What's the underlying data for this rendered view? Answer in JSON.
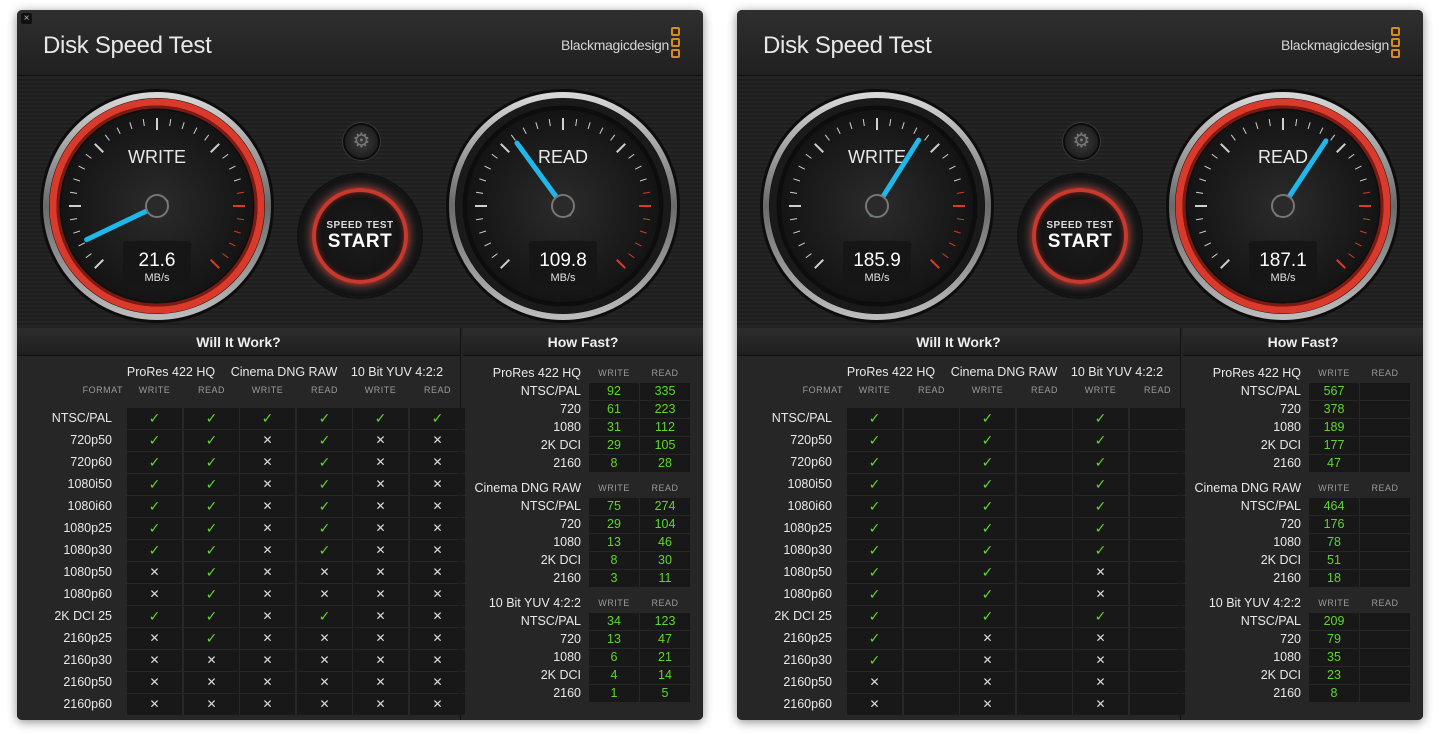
{
  "windows": [
    {
      "close_label": "×",
      "title": "Disk Speed Test",
      "brand": "Blackmagicdesign",
      "write_gauge": {
        "label": "WRITE",
        "value": "21.6",
        "unit": "MB/s",
        "needle_mbps": 21.6
      },
      "read_gauge": {
        "label": "READ",
        "value": "109.8",
        "unit": "MB/s",
        "needle_mbps": 109.8
      },
      "gauge_max_mbps": 300,
      "active_gauge": "write",
      "start_button": {
        "line1": "SPEED TEST",
        "line2": "START"
      },
      "will_it_work": {
        "title": "Will It Work?",
        "format_label": "FORMAT",
        "codecs": [
          "ProRes 422 HQ",
          "Cinema DNG RAW",
          "10 Bit YUV 4:2:2"
        ],
        "subcols": [
          "WRITE",
          "READ"
        ],
        "rows": [
          {
            "format": "NTSC/PAL",
            "cells": [
              "ok",
              "ok",
              "ok",
              "ok",
              "ok",
              "ok"
            ]
          },
          {
            "format": "720p50",
            "cells": [
              "ok",
              "ok",
              "no",
              "ok",
              "no",
              "no"
            ]
          },
          {
            "format": "720p60",
            "cells": [
              "ok",
              "ok",
              "no",
              "ok",
              "no",
              "no"
            ]
          },
          {
            "format": "1080i50",
            "cells": [
              "ok",
              "ok",
              "no",
              "ok",
              "no",
              "no"
            ]
          },
          {
            "format": "1080i60",
            "cells": [
              "ok",
              "ok",
              "no",
              "ok",
              "no",
              "no"
            ]
          },
          {
            "format": "1080p25",
            "cells": [
              "ok",
              "ok",
              "no",
              "ok",
              "no",
              "no"
            ]
          },
          {
            "format": "1080p30",
            "cells": [
              "ok",
              "ok",
              "no",
              "ok",
              "no",
              "no"
            ]
          },
          {
            "format": "1080p50",
            "cells": [
              "no",
              "ok",
              "no",
              "no",
              "no",
              "no"
            ]
          },
          {
            "format": "1080p60",
            "cells": [
              "no",
              "ok",
              "no",
              "no",
              "no",
              "no"
            ]
          },
          {
            "format": "2K DCI 25",
            "cells": [
              "ok",
              "ok",
              "no",
              "ok",
              "no",
              "no"
            ]
          },
          {
            "format": "2160p25",
            "cells": [
              "no",
              "ok",
              "no",
              "no",
              "no",
              "no"
            ]
          },
          {
            "format": "2160p30",
            "cells": [
              "no",
              "no",
              "no",
              "no",
              "no",
              "no"
            ]
          },
          {
            "format": "2160p50",
            "cells": [
              "no",
              "no",
              "no",
              "no",
              "no",
              "no"
            ]
          },
          {
            "format": "2160p60",
            "cells": [
              "no",
              "no",
              "no",
              "no",
              "no",
              "no"
            ]
          }
        ]
      },
      "how_fast": {
        "title": "How Fast?",
        "write_label": "WRITE",
        "read_label": "READ",
        "groups": [
          {
            "name": "ProRes 422 HQ",
            "rows": [
              {
                "res": "NTSC/PAL",
                "write": "92",
                "read": "335"
              },
              {
                "res": "720",
                "write": "61",
                "read": "223"
              },
              {
                "res": "1080",
                "write": "31",
                "read": "112"
              },
              {
                "res": "2K DCI",
                "write": "29",
                "read": "105"
              },
              {
                "res": "2160",
                "write": "8",
                "read": "28"
              }
            ]
          },
          {
            "name": "Cinema DNG RAW",
            "rows": [
              {
                "res": "NTSC/PAL",
                "write": "75",
                "read": "274"
              },
              {
                "res": "720",
                "write": "29",
                "read": "104"
              },
              {
                "res": "1080",
                "write": "13",
                "read": "46"
              },
              {
                "res": "2K DCI",
                "write": "8",
                "read": "30"
              },
              {
                "res": "2160",
                "write": "3",
                "read": "11"
              }
            ]
          },
          {
            "name": "10 Bit YUV 4:2:2",
            "rows": [
              {
                "res": "NTSC/PAL",
                "write": "34",
                "read": "123"
              },
              {
                "res": "720",
                "write": "13",
                "read": "47"
              },
              {
                "res": "1080",
                "write": "6",
                "read": "21"
              },
              {
                "res": "2K DCI",
                "write": "4",
                "read": "14"
              },
              {
                "res": "2160",
                "write": "1",
                "read": "5"
              }
            ]
          }
        ]
      }
    },
    {
      "close_label": "",
      "title": "Disk Speed Test",
      "brand": "Blackmagicdesign",
      "write_gauge": {
        "label": "WRITE",
        "value": "185.9",
        "unit": "MB/s",
        "needle_mbps": 185.9
      },
      "read_gauge": {
        "label": "READ",
        "value": "187.1",
        "unit": "MB/s",
        "needle_mbps": 187.1
      },
      "gauge_max_mbps": 300,
      "active_gauge": "read",
      "start_button": {
        "line1": "SPEED TEST",
        "line2": "START"
      },
      "will_it_work": {
        "title": "Will It Work?",
        "format_label": "FORMAT",
        "codecs": [
          "ProRes 422 HQ",
          "Cinema DNG RAW",
          "10 Bit YUV 4:2:2"
        ],
        "subcols": [
          "WRITE",
          "READ"
        ],
        "rows": [
          {
            "format": "NTSC/PAL",
            "cells": [
              "ok",
              "",
              "ok",
              "",
              "ok",
              ""
            ]
          },
          {
            "format": "720p50",
            "cells": [
              "ok",
              "",
              "ok",
              "",
              "ok",
              ""
            ]
          },
          {
            "format": "720p60",
            "cells": [
              "ok",
              "",
              "ok",
              "",
              "ok",
              ""
            ]
          },
          {
            "format": "1080i50",
            "cells": [
              "ok",
              "",
              "ok",
              "",
              "ok",
              ""
            ]
          },
          {
            "format": "1080i60",
            "cells": [
              "ok",
              "",
              "ok",
              "",
              "ok",
              ""
            ]
          },
          {
            "format": "1080p25",
            "cells": [
              "ok",
              "",
              "ok",
              "",
              "ok",
              ""
            ]
          },
          {
            "format": "1080p30",
            "cells": [
              "ok",
              "",
              "ok",
              "",
              "ok",
              ""
            ]
          },
          {
            "format": "1080p50",
            "cells": [
              "ok",
              "",
              "ok",
              "",
              "no",
              ""
            ]
          },
          {
            "format": "1080p60",
            "cells": [
              "ok",
              "",
              "ok",
              "",
              "no",
              ""
            ]
          },
          {
            "format": "2K DCI 25",
            "cells": [
              "ok",
              "",
              "ok",
              "",
              "ok",
              ""
            ]
          },
          {
            "format": "2160p25",
            "cells": [
              "ok",
              "",
              "no",
              "",
              "no",
              ""
            ]
          },
          {
            "format": "2160p30",
            "cells": [
              "ok",
              "",
              "no",
              "",
              "no",
              ""
            ]
          },
          {
            "format": "2160p50",
            "cells": [
              "no",
              "",
              "no",
              "",
              "no",
              ""
            ]
          },
          {
            "format": "2160p60",
            "cells": [
              "no",
              "",
              "no",
              "",
              "no",
              ""
            ]
          }
        ]
      },
      "how_fast": {
        "title": "How Fast?",
        "write_label": "WRITE",
        "read_label": "READ",
        "groups": [
          {
            "name": "ProRes 422 HQ",
            "rows": [
              {
                "res": "NTSC/PAL",
                "write": "567",
                "read": ""
              },
              {
                "res": "720",
                "write": "378",
                "read": ""
              },
              {
                "res": "1080",
                "write": "189",
                "read": ""
              },
              {
                "res": "2K DCI",
                "write": "177",
                "read": ""
              },
              {
                "res": "2160",
                "write": "47",
                "read": ""
              }
            ]
          },
          {
            "name": "Cinema DNG RAW",
            "rows": [
              {
                "res": "NTSC/PAL",
                "write": "464",
                "read": ""
              },
              {
                "res": "720",
                "write": "176",
                "read": ""
              },
              {
                "res": "1080",
                "write": "78",
                "read": ""
              },
              {
                "res": "2K DCI",
                "write": "51",
                "read": ""
              },
              {
                "res": "2160",
                "write": "18",
                "read": ""
              }
            ]
          },
          {
            "name": "10 Bit YUV 4:2:2",
            "rows": [
              {
                "res": "NTSC/PAL",
                "write": "209",
                "read": ""
              },
              {
                "res": "720",
                "write": "79",
                "read": ""
              },
              {
                "res": "1080",
                "write": "35",
                "read": ""
              },
              {
                "res": "2K DCI",
                "write": "23",
                "read": ""
              },
              {
                "res": "2160",
                "write": "8",
                "read": ""
              }
            ]
          }
        ]
      }
    }
  ],
  "icons": {
    "check": "✓",
    "cross": "✕",
    "gear": "⚙"
  },
  "colors": {
    "pass": "#5fd62b",
    "fail": "#dcdcdc",
    "needle": "#1fb8ea",
    "active_ring": "#d93a2b",
    "brand_logo": "#d58a23"
  }
}
